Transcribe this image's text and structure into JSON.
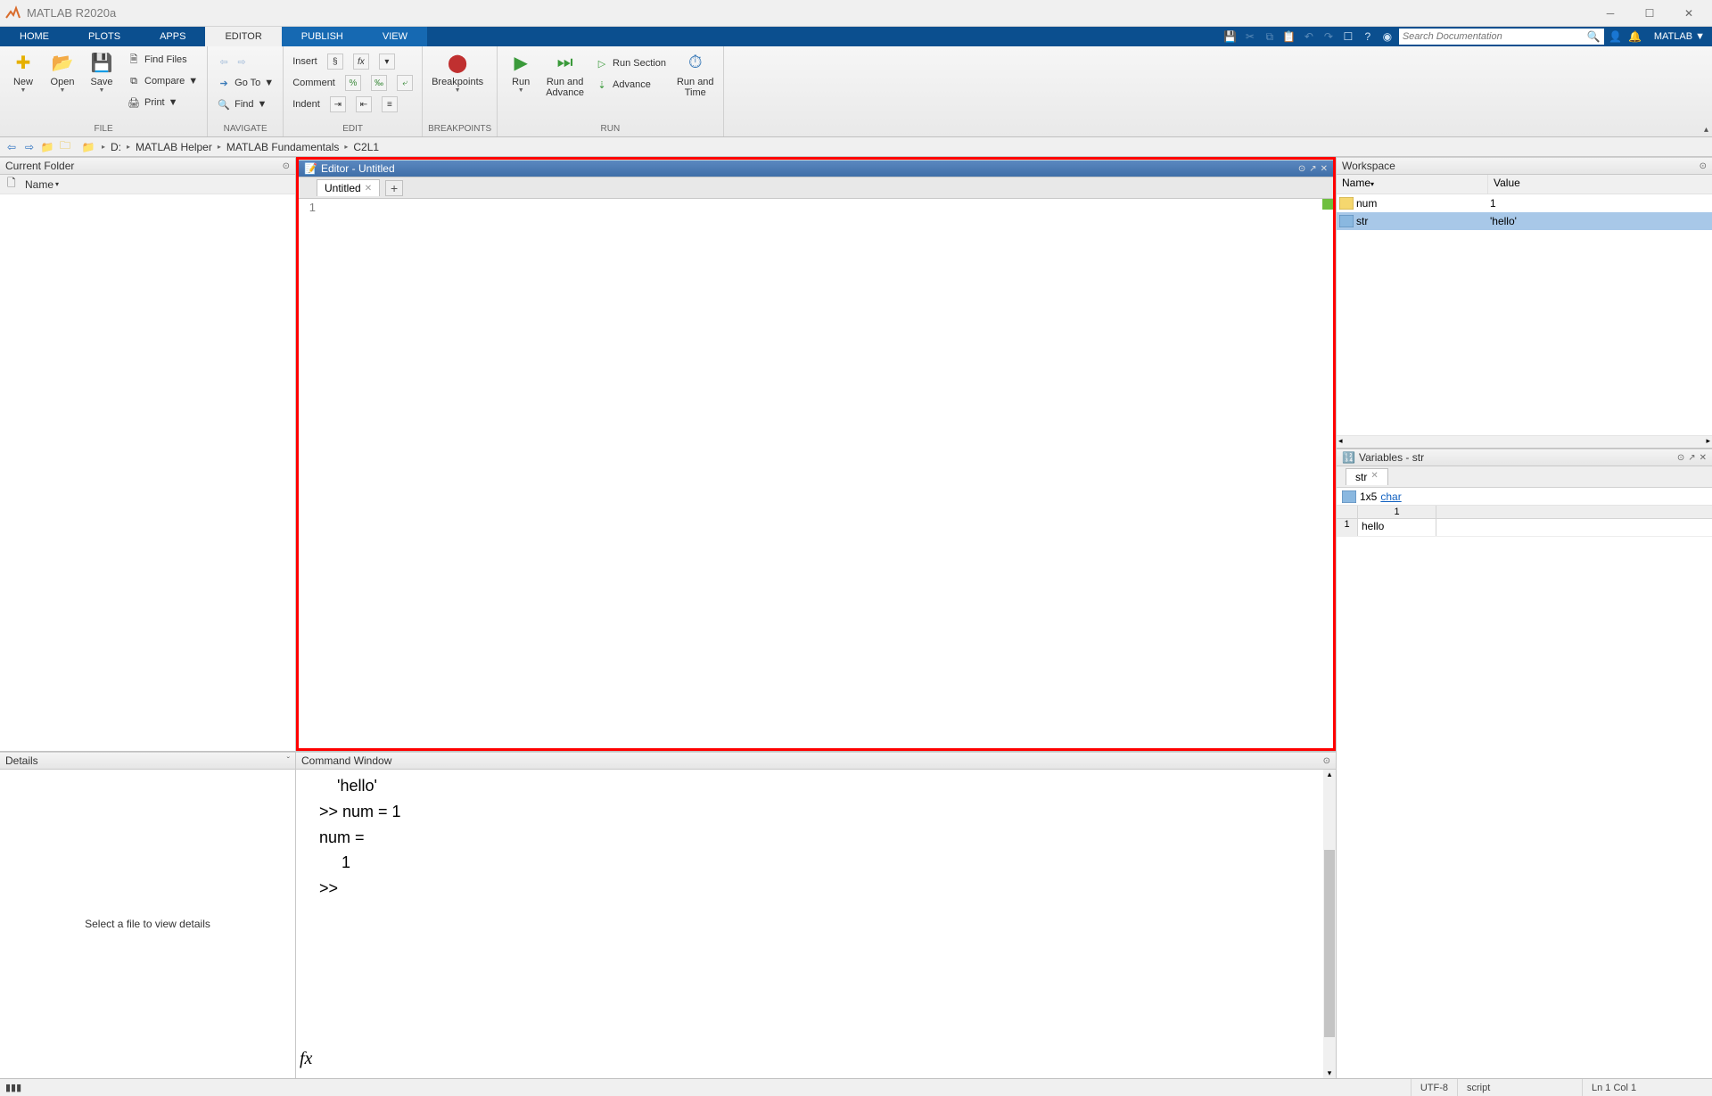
{
  "app": {
    "title": "MATLAB R2020a",
    "user": "MATLAB"
  },
  "tabs": {
    "home": "HOME",
    "plots": "PLOTS",
    "apps": "APPS",
    "editor": "EDITOR",
    "publish": "PUBLISH",
    "view": "VIEW"
  },
  "search": {
    "placeholder": "Search Documentation"
  },
  "toolstrip": {
    "file": {
      "new": "New",
      "open": "Open",
      "save": "Save",
      "find_files": "Find Files",
      "compare": "Compare",
      "print": "Print",
      "group": "FILE"
    },
    "navigate": {
      "goto": "Go To",
      "find": "Find",
      "group": "NAVIGATE"
    },
    "edit": {
      "insert": "Insert",
      "comment": "Comment",
      "indent": "Indent",
      "group": "EDIT"
    },
    "breakpoints": {
      "btn": "Breakpoints",
      "group": "BREAKPOINTS"
    },
    "run": {
      "run": "Run",
      "run_advance": "Run and\nAdvance",
      "run_section": "Run Section",
      "advance": "Advance",
      "run_time": "Run and\nTime",
      "group": "RUN"
    }
  },
  "addr": {
    "drive": "D:",
    "p1": "MATLAB Helper",
    "p2": "MATLAB Fundamentals",
    "p3": "C2L1"
  },
  "panels": {
    "current_folder": "Current Folder",
    "name_col": "Name",
    "editor": "Editor - Untitled",
    "editor_tab": "Untitled",
    "command": "Command Window",
    "workspace": "Workspace",
    "ws_name": "Name",
    "ws_value": "Value",
    "variables": "Variables - str",
    "var_tab": "str",
    "details": "Details",
    "details_msg": "Select a file to view details"
  },
  "editor": {
    "line1_no": "1"
  },
  "cmd": {
    "l1": "    'hello'",
    "l2": "",
    "l3": ">> num = 1",
    "l4": "",
    "l5": "num =",
    "l6": "",
    "l7": "     1",
    "l8": "",
    "prompt": ">> "
  },
  "workspace": {
    "rows": [
      {
        "name": "num",
        "value": "1"
      },
      {
        "name": "str",
        "value": "'hello'"
      }
    ]
  },
  "var": {
    "dim": "1x5",
    "type": "char",
    "col1": "1",
    "rh1": "1",
    "cell": "hello"
  },
  "status": {
    "encoding": "UTF-8",
    "mode": "script",
    "pos": "Ln  1   Col  1"
  }
}
